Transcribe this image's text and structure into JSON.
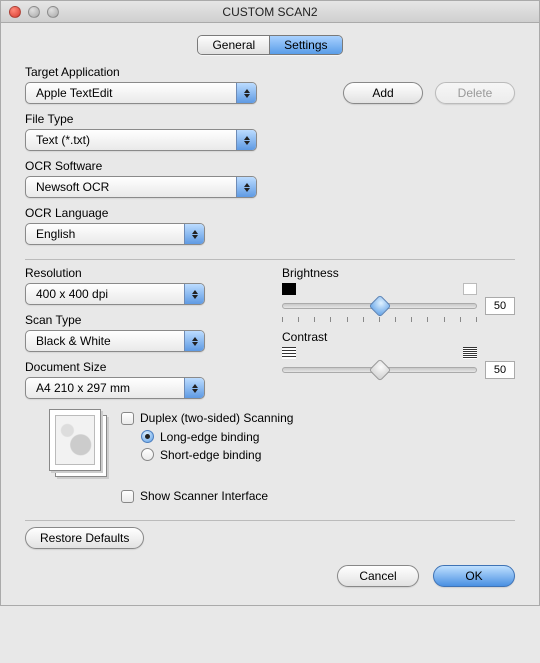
{
  "window": {
    "title": "CUSTOM SCAN2"
  },
  "tabs": {
    "general": "General",
    "settings": "Settings"
  },
  "targetApp": {
    "label": "Target Application",
    "value": "Apple TextEdit",
    "addLabel": "Add",
    "deleteLabel": "Delete"
  },
  "fileType": {
    "label": "File Type",
    "value": "Text (*.txt)"
  },
  "ocrSoftware": {
    "label": "OCR Software",
    "value": "Newsoft OCR"
  },
  "ocrLanguage": {
    "label": "OCR Language",
    "value": "English"
  },
  "resolution": {
    "label": "Resolution",
    "value": "400 x 400 dpi"
  },
  "scanType": {
    "label": "Scan Type",
    "value": "Black & White"
  },
  "documentSize": {
    "label": "Document Size",
    "value": "A4  210 x 297 mm"
  },
  "brightness": {
    "label": "Brightness",
    "value": "50"
  },
  "contrast": {
    "label": "Contrast",
    "value": "50"
  },
  "duplex": {
    "label": "Duplex (two-sided) Scanning",
    "longEdge": "Long-edge binding",
    "shortEdge": "Short-edge binding"
  },
  "showScanner": {
    "label": "Show Scanner Interface"
  },
  "restoreDefaults": "Restore Defaults",
  "cancel": "Cancel",
  "ok": "OK"
}
